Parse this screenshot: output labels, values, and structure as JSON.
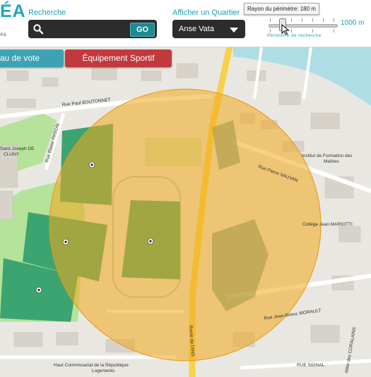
{
  "header": {
    "logo_text": "ÉA",
    "logo_subtext": "éa",
    "search": {
      "label": "Recherche",
      "value": "",
      "placeholder": "",
      "button_label": "GO"
    },
    "quartier": {
      "label": "Afficher un Quartier",
      "selected": "Anse Vata"
    },
    "perimeter": {
      "tooltip": "Rayon du périmètre: 180 m",
      "max_label": "1000 m",
      "caption": "Périmètre de recherche",
      "value_m": 180,
      "max_m": 1000
    }
  },
  "tabs": [
    {
      "label": "au de vote"
    },
    {
      "label": "Équipement Sportif"
    }
  ],
  "map": {
    "colors": {
      "circle": "#f2a81e",
      "sea": "#aedde6",
      "park": "#b5e39a",
      "field": "#3ca470",
      "road_main": "#f5d24a"
    },
    "markers": [
      "ball-icon",
      "ball-icon",
      "ball-icon",
      "ball-icon",
      "ball-icon"
    ],
    "labels": {
      "rue_paul": "Rue Paul BOUTONNET",
      "rue_blaise": "Rue Blaise PASCAL",
      "saint_joseph": "Saint Joseph DE",
      "cluny": "CLUNY",
      "rue_pierre": "Rue Pierre SAUVAN",
      "institut1": "Institut de Formation des",
      "institut2": "Maîtres",
      "college": "Collège Jean MARIOTTI",
      "route": "Route de l'ANS",
      "rue_jean": "Rue Jean-Brieuc MORAULT",
      "haut1": "Haut Commissariat de la République",
      "haut2": "Logements",
      "rue_signal": "RUE SIGNAL",
      "allee": "Allée des CORALAINS"
    }
  }
}
